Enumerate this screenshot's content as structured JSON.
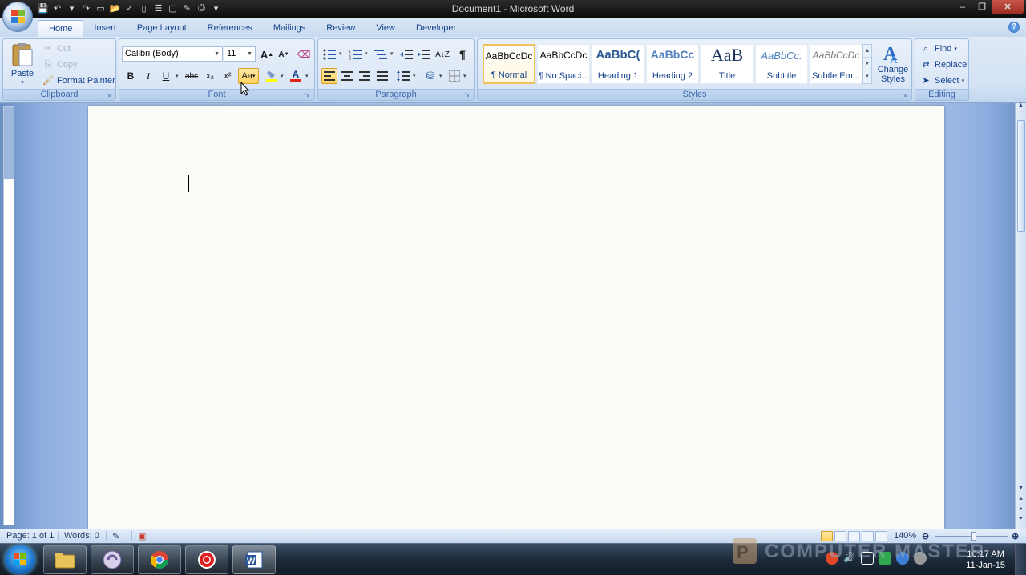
{
  "window": {
    "title_doc": "Document1",
    "title_sep": " - ",
    "title_app": "Microsoft Word",
    "minimize_glyph": "–",
    "restore_glyph": "❐",
    "close_glyph": "✕"
  },
  "qat": {
    "icons": [
      "save-icon",
      "undo-icon",
      "redo-icon",
      "new-icon",
      "open-icon",
      "spelling-icon",
      "new-doc-icon",
      "outline-icon",
      "page-icon",
      "edit-icon",
      "print-icon",
      "customize-icon"
    ]
  },
  "tabs": [
    {
      "label": "Home",
      "active": true
    },
    {
      "label": "Insert"
    },
    {
      "label": "Page Layout"
    },
    {
      "label": "References"
    },
    {
      "label": "Mailings"
    },
    {
      "label": "Review"
    },
    {
      "label": "View"
    },
    {
      "label": "Developer"
    }
  ],
  "clipboard": {
    "label": "Clipboard",
    "paste": "Paste",
    "cut": "Cut",
    "copy": "Copy",
    "format_painter": "Format Painter"
  },
  "font": {
    "label": "Font",
    "font_name": "Calibri (Body)",
    "font_size": "11",
    "bold": "B",
    "italic": "I",
    "underline": "U",
    "strikethrough": "abc",
    "subscript": "x₂",
    "superscript": "x²",
    "change_case": "Aa",
    "grow": "A",
    "shrink": "A",
    "font_color": "A",
    "highlight_color": "#ffff00",
    "font_color_value": "#e0261a"
  },
  "paragraph": {
    "label": "Paragraph",
    "pilcrow": "¶"
  },
  "styles": {
    "label": "Styles",
    "items": [
      {
        "sample": "AaBbCcDc",
        "name": "¶ Normal"
      },
      {
        "sample": "AaBbCcDc",
        "name": "¶ No Spaci..."
      },
      {
        "sample": "AaBbC(",
        "name": "Heading 1"
      },
      {
        "sample": "AaBbCc",
        "name": "Heading 2"
      },
      {
        "sample": "AaB",
        "name": "Title"
      },
      {
        "sample": "AaBbCc.",
        "name": "Subtitle"
      },
      {
        "sample": "AaBbCcDc",
        "name": "Subtle Em..."
      }
    ],
    "change_styles_line1": "Change",
    "change_styles_line2": "Styles"
  },
  "editing": {
    "label": "Editing",
    "find": "Find",
    "replace": "Replace",
    "select": "Select"
  },
  "statusbar": {
    "page": "Page: 1 of 1",
    "words": "Words: 0",
    "zoom": "140%"
  },
  "taskbar": {
    "apps": [
      "file-explorer-icon",
      "torrent-app-icon",
      "chrome-icon",
      "screen-recorder-icon",
      "word-icon"
    ],
    "time": "10:17 AM",
    "date": "11-Jan-15"
  },
  "watermark": {
    "text": "COMPUTER MASTER"
  }
}
